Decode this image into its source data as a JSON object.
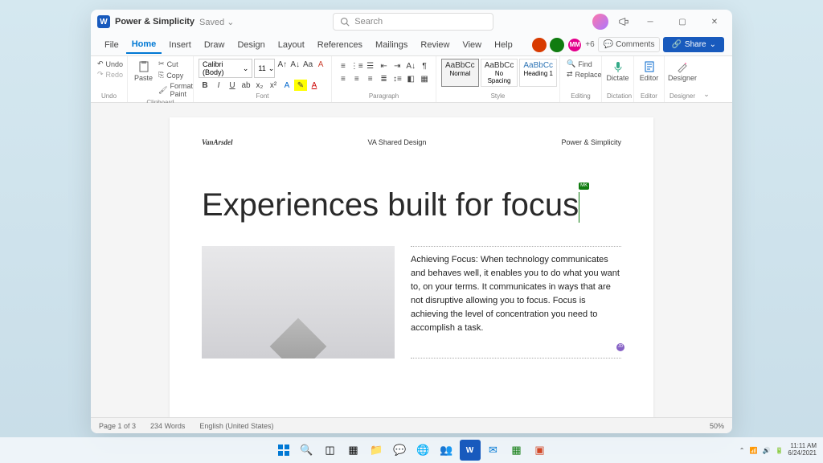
{
  "titlebar": {
    "doc": "Power & Simplicity",
    "saved": "Saved",
    "search": "Search"
  },
  "tabs": [
    "File",
    "Home",
    "Insert",
    "Draw",
    "Design",
    "Layout",
    "References",
    "Mailings",
    "Review",
    "View",
    "Help"
  ],
  "active_tab": "Home",
  "collab": {
    "more": "+6",
    "comments": "Comments",
    "share": "Share"
  },
  "ribbon": {
    "undo": {
      "undo": "Undo",
      "redo": "Redo",
      "label": "Undo"
    },
    "clipboard": {
      "paste": "Paste",
      "cut": "Cut",
      "copy": "Copy",
      "fp": "Format Paint",
      "label": "Clipboard"
    },
    "font": {
      "name": "Calibri (Body)",
      "size": "11",
      "label": "Font"
    },
    "para": {
      "label": "Paragraph"
    },
    "styles": {
      "s1": "Normal",
      "s2": "No Spacing",
      "s3": "Heading 1",
      "prev": "AaBbCc",
      "label": "Style"
    },
    "editing": {
      "find": "Find",
      "replace": "Replace",
      "label": "Editing"
    },
    "dictate": {
      "btn": "Dictate",
      "label": "Dictation"
    },
    "editor": {
      "btn": "Editor",
      "label": "Editor"
    },
    "designer": {
      "btn": "Designer",
      "label": "Designer"
    }
  },
  "doc": {
    "brand": "VanArsdel",
    "shared": "VA Shared Design",
    "hr": "Power & Simplicity",
    "h": "Experiences built for focus",
    "cursor_user": "MK",
    "body": "Achieving Focus: When technology communicates and behaves well, it enables you to do what you want to, on your terms. It communicates in ways that are not disruptive allowing you to focus. Focus is achieving the level of concentration you need to accomplish a task.",
    "tag2": "JD"
  },
  "status": {
    "page": "Page 1 of 3",
    "words": "234 Words",
    "lang": "English (United States)",
    "zoom": "50%"
  },
  "tray": {
    "time": "11:11 AM",
    "date": "6/24/2021"
  }
}
